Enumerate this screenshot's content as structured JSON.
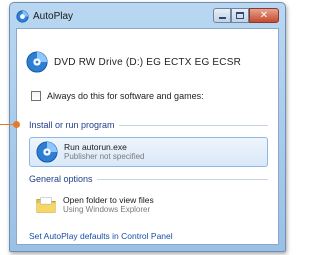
{
  "window": {
    "title": "AutoPlay",
    "buttons": {
      "minimize": "minimize",
      "maximize": "maximize",
      "close": "✕"
    }
  },
  "drive": {
    "label": "DVD RW Drive (D:) EG ECTX EG ECSR"
  },
  "always": {
    "label": "Always do this for software and games:",
    "checked": false
  },
  "install_section": {
    "title": "Install or run program",
    "option": {
      "title": "Run autorun.exe",
      "subtitle": "Publisher not specified"
    }
  },
  "general_section": {
    "title": "General options",
    "option": {
      "title": "Open folder to view files",
      "subtitle": "Using Windows Explorer"
    }
  },
  "footer": {
    "link": "Set AutoPlay defaults in Control Panel"
  },
  "colors": {
    "accent": "#1e3f8a",
    "callout": "#e27b2a",
    "link": "#1a4fa8"
  }
}
